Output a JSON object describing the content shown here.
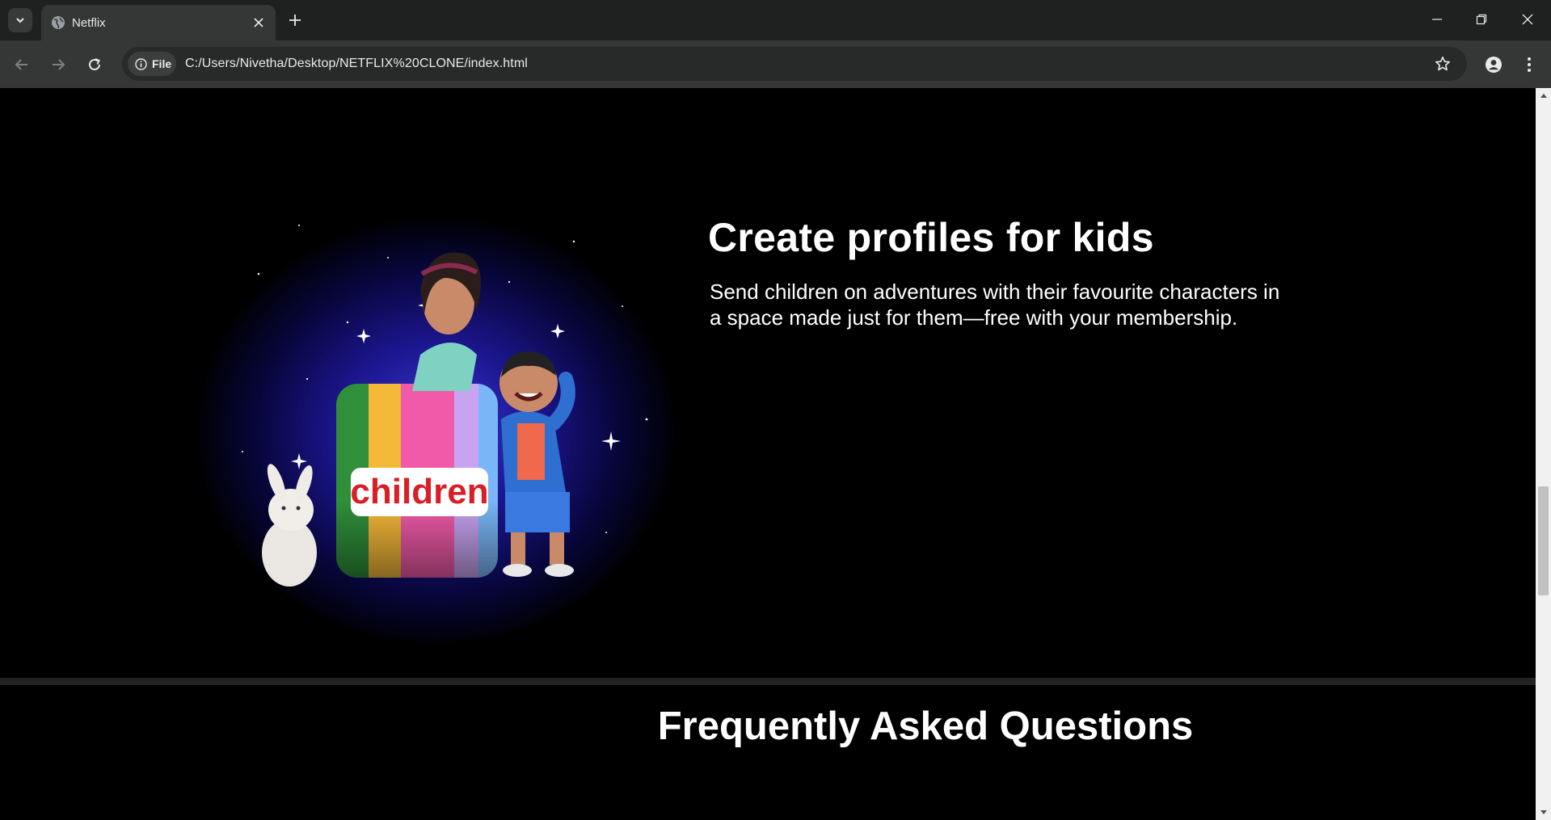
{
  "browser": {
    "tab_title": "Netflix",
    "chip_label": "File",
    "url": "C:/Users/Nivetha/Desktop/NETFLIX%20CLONE/index.html",
    "icons": [
      "tab-search-icon",
      "globe-icon",
      "close-icon",
      "plus-icon",
      "minimize-icon",
      "restore-icon",
      "window-close-icon",
      "back-arrow-icon",
      "forward-arrow-icon",
      "reload-icon",
      "info-icon",
      "star-icon",
      "profile-icon",
      "kebab-menu-icon"
    ]
  },
  "kids_section": {
    "heading": "Create profiles for kids",
    "description": "Send children on adventures with their favourite characters in a space made just for them—free with your membership.",
    "badge_text": "children",
    "badge_colors": [
      "#2f8f3a",
      "#f5b93a",
      "#f05aa8",
      "#c7a3f0",
      "#7ab6f7"
    ]
  },
  "faq_section": {
    "heading": "Frequently Asked Questions"
  }
}
